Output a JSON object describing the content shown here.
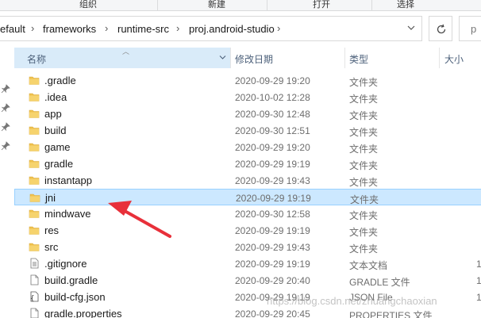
{
  "ribbon": {
    "labels": [
      "组织",
      "新建",
      "打开",
      "选择"
    ]
  },
  "breadcrumb": {
    "items": [
      "efault",
      "frameworks",
      "runtime-src",
      "proj.android-studio"
    ]
  },
  "search": {
    "icon_glyph": "p"
  },
  "columns": {
    "name": "名称",
    "modified": "修改日期",
    "type": "类型",
    "size": "大小"
  },
  "files": [
    {
      "name": ".gradle",
      "modified": "2020-09-29 19:20",
      "type": "文件夹",
      "size": "",
      "icon": "folder-icon"
    },
    {
      "name": ".idea",
      "modified": "2020-10-02 12:28",
      "type": "文件夹",
      "size": "",
      "icon": "folder-icon"
    },
    {
      "name": "app",
      "modified": "2020-09-30 12:48",
      "type": "文件夹",
      "size": "",
      "icon": "folder-icon"
    },
    {
      "name": "build",
      "modified": "2020-09-30 12:51",
      "type": "文件夹",
      "size": "",
      "icon": "folder-icon"
    },
    {
      "name": "game",
      "modified": "2020-09-29 19:20",
      "type": "文件夹",
      "size": "",
      "icon": "folder-icon"
    },
    {
      "name": "gradle",
      "modified": "2020-09-29 19:19",
      "type": "文件夹",
      "size": "",
      "icon": "folder-icon"
    },
    {
      "name": "instantapp",
      "modified": "2020-09-29 19:43",
      "type": "文件夹",
      "size": "",
      "icon": "folder-icon"
    },
    {
      "name": "jni",
      "modified": "2020-09-29 19:19",
      "type": "文件夹",
      "size": "",
      "icon": "folder-icon",
      "selected": true
    },
    {
      "name": "mindwave",
      "modified": "2020-09-30 12:58",
      "type": "文件夹",
      "size": "",
      "icon": "folder-icon"
    },
    {
      "name": "res",
      "modified": "2020-09-29 19:19",
      "type": "文件夹",
      "size": "",
      "icon": "folder-icon"
    },
    {
      "name": "src",
      "modified": "2020-09-29 19:43",
      "type": "文件夹",
      "size": "",
      "icon": "folder-icon"
    },
    {
      "name": ".gitignore",
      "modified": "2020-09-29 19:19",
      "type": "文本文档",
      "size": "1",
      "icon": "text-file-icon"
    },
    {
      "name": "build.gradle",
      "modified": "2020-09-29 20:40",
      "type": "GRADLE 文件",
      "size": "1",
      "icon": "file-icon"
    },
    {
      "name": "build-cfg.json",
      "modified": "2020-09-29 19:19",
      "type": "JSON File",
      "size": "1",
      "icon": "json-file-icon"
    },
    {
      "name": "gradle.properties",
      "modified": "2020-09-29 20:45",
      "type": "PROPERTIES 文件",
      "size": "",
      "icon": "file-icon"
    }
  ],
  "watermark": "https://blog.csdn.net/zhuangchaoxian",
  "colors": {
    "selection_bg": "#cce8ff",
    "selection_border": "#99d1ff",
    "header_bg": "#d9ebf9",
    "folder": "#f0c24e",
    "arrow": "#e8303a"
  }
}
